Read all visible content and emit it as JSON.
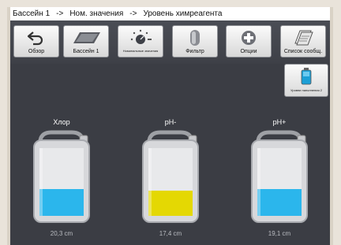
{
  "breadcrumb": {
    "items": [
      "Бассейн 1",
      "Ном. значения",
      "Уровень химреагента"
    ],
    "separator": "->"
  },
  "toolbar": [
    {
      "label": "Обзор",
      "icon": "back-arrow-icon"
    },
    {
      "label": "Бассейн 1",
      "icon": "pool-icon"
    },
    {
      "label": "Номинальные значения",
      "icon": "gauge-icon"
    },
    {
      "label": "Фильтр",
      "icon": "filter-icon"
    },
    {
      "label": "Опции",
      "icon": "plus-icon"
    },
    {
      "label": "Список сообщ.",
      "icon": "messages-icon"
    }
  ],
  "side_button": {
    "label": "Уровни наполнения 2",
    "icon": "canister-icon"
  },
  "tanks": [
    {
      "name": "Хлор",
      "value": "20,3 cm",
      "fill": 0.4,
      "color": "#2bb6ec"
    },
    {
      "name": "pH-",
      "value": "17,4 cm",
      "fill": 0.37,
      "color": "#e4d803"
    },
    {
      "name": "pH+",
      "value": "19,1 cm",
      "fill": 0.39,
      "color": "#2bb6ec"
    }
  ]
}
